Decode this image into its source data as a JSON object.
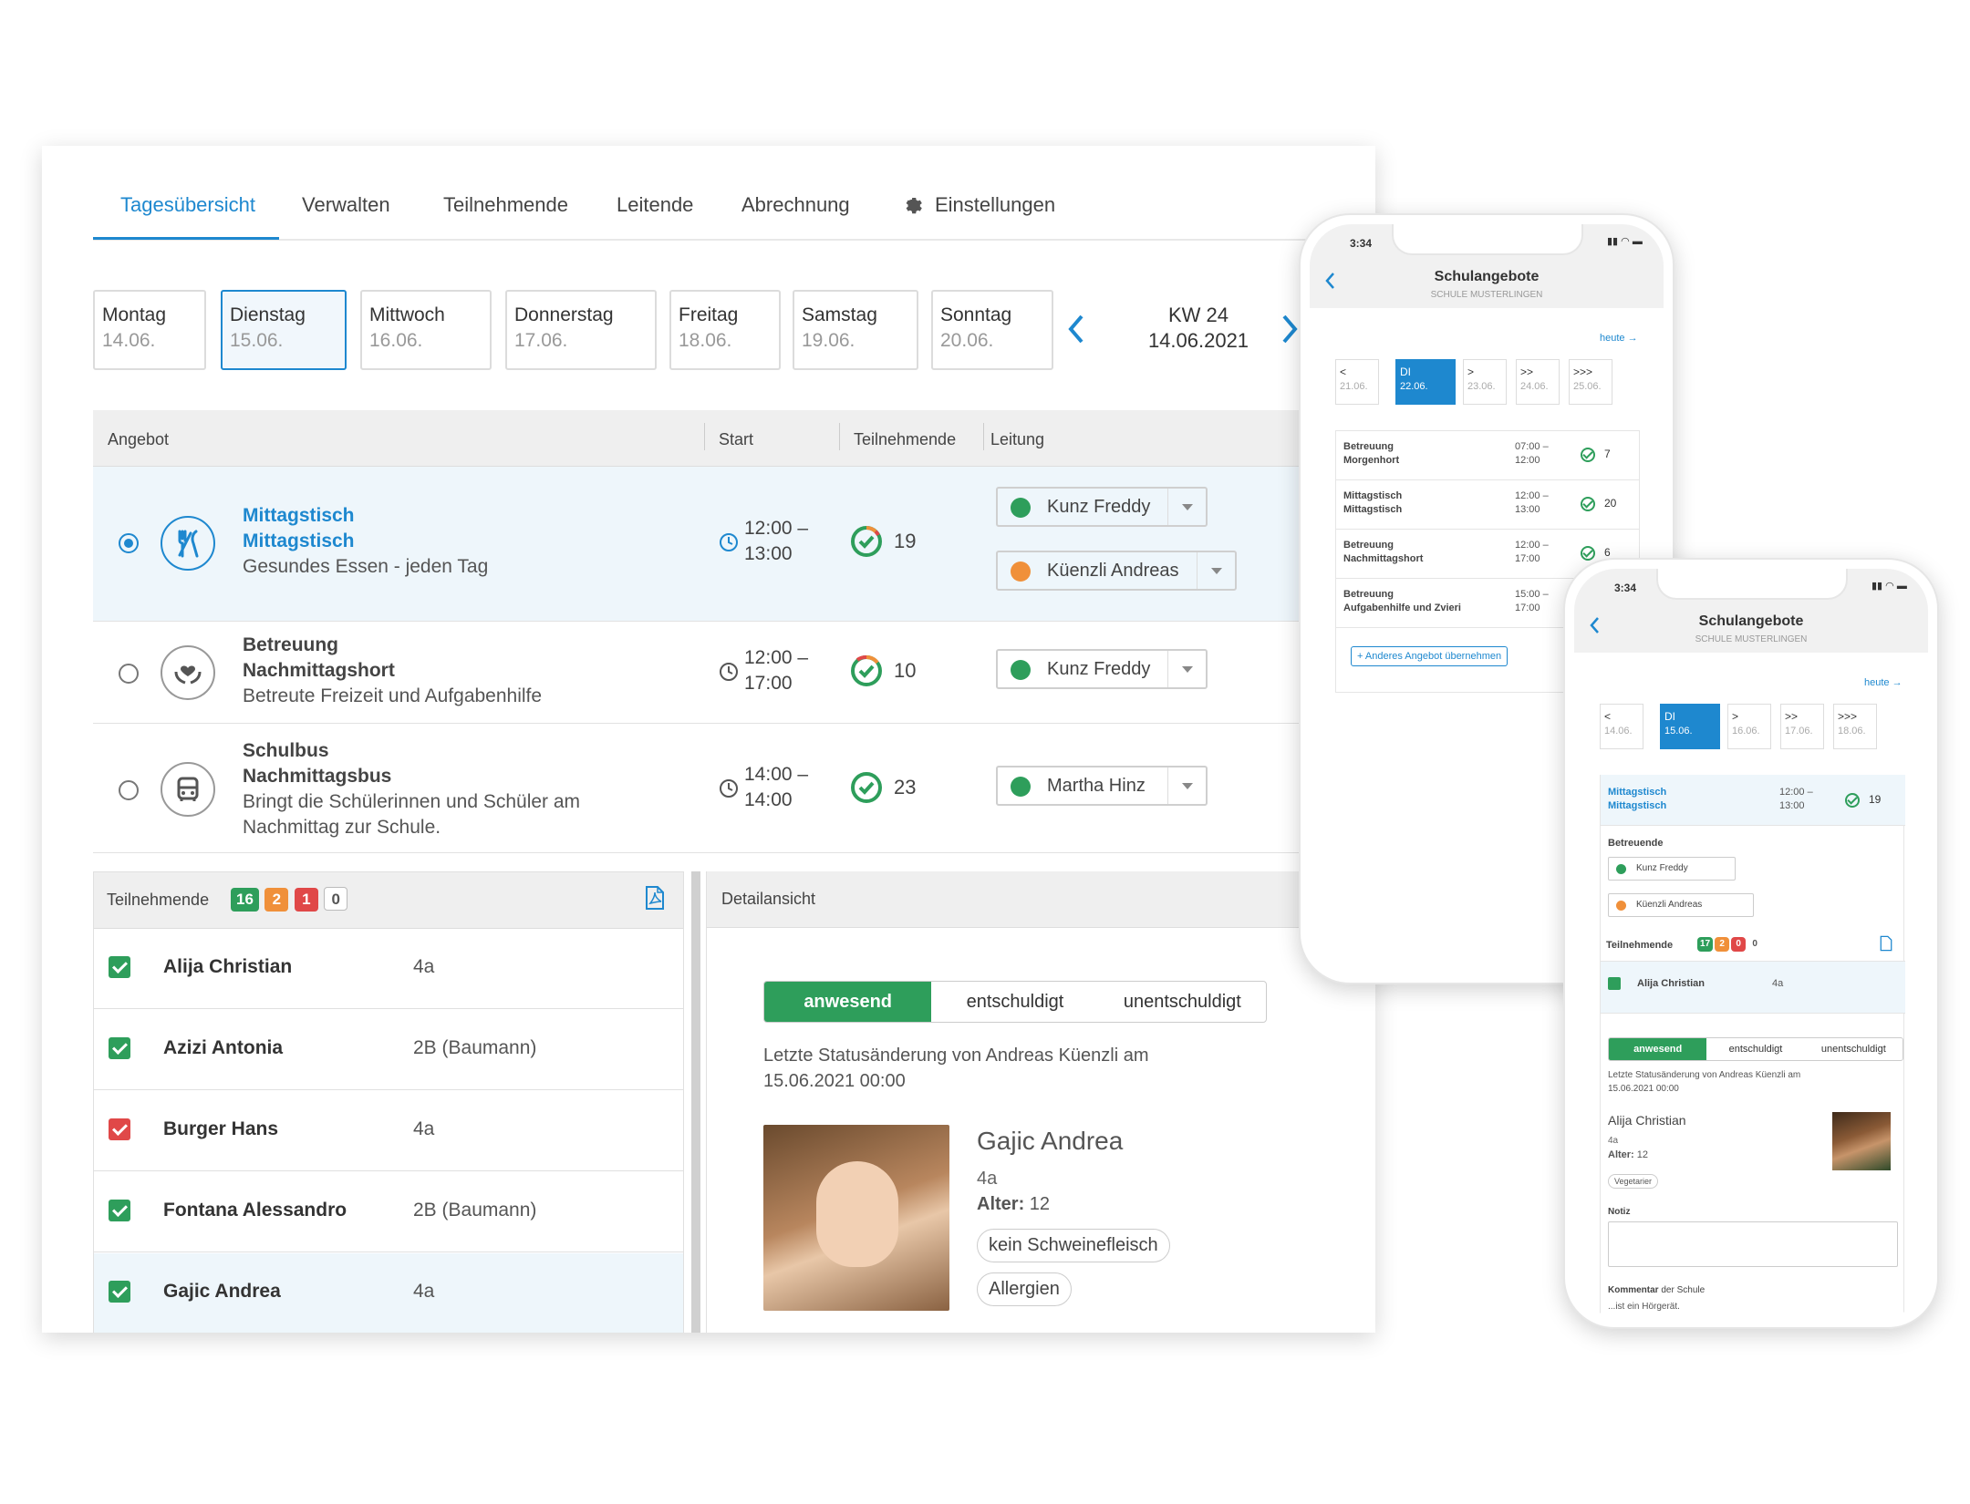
{
  "tabs": [
    "Tagesübersicht",
    "Verwalten",
    "Teilnehmende",
    "Leitende",
    "Abrechnung",
    "Einstellungen"
  ],
  "days": [
    {
      "name": "Montag",
      "date": "14.06."
    },
    {
      "name": "Dienstag",
      "date": "15.06."
    },
    {
      "name": "Mittwoch",
      "date": "16.06."
    },
    {
      "name": "Donnerstag",
      "date": "17.06."
    },
    {
      "name": "Freitag",
      "date": "18.06."
    },
    {
      "name": "Samstag",
      "date": "19.06."
    },
    {
      "name": "Sonntag",
      "date": "20.06."
    }
  ],
  "week": {
    "label": "KW 24",
    "date": "14.06.2021"
  },
  "table": {
    "headers": [
      "Angebot",
      "Start",
      "Teilnehmende",
      "Leitung"
    ],
    "rows": [
      {
        "line1": "Mittagstisch",
        "line2": "Mittagstisch",
        "line3": "Gesundes Essen - jeden Tag",
        "start": "12:00 –",
        "end": "13:00",
        "count": "19",
        "leaders": [
          "Kunz Freddy",
          "Küenzli Andreas"
        ]
      },
      {
        "line1": "Betreuung",
        "line2": "Nachmittagshort",
        "line3": "Betreute Freizeit und Aufgabenhilfe",
        "start": "12:00 –",
        "end": "17:00",
        "count": "10",
        "leaders": [
          "Kunz Freddy"
        ]
      },
      {
        "line1": "Schulbus",
        "line2": "Nachmittagsbus",
        "line3": "Bringt die Schülerinnen und Schüler am",
        "line4": "Nachmittag zur Schule.",
        "start": "14:00 –",
        "end": "14:00",
        "count": "23",
        "leaders": [
          "Martha Hinz"
        ]
      }
    ]
  },
  "participants": {
    "title": "Teilnehmende",
    "badges": [
      "16",
      "2",
      "1",
      "0"
    ],
    "list": [
      {
        "name": "Alija Christian",
        "class": "4a",
        "status": "present"
      },
      {
        "name": "Azizi Antonia",
        "class": "2B (Baumann)",
        "status": "present"
      },
      {
        "name": "Burger Hans",
        "class": "4a",
        "status": "absent"
      },
      {
        "name": "Fontana Alessandro",
        "class": "2B (Baumann)",
        "status": "present"
      },
      {
        "name": "Gajic Andrea",
        "class": "4a",
        "status": "present"
      }
    ]
  },
  "detail": {
    "title": "Detailansicht",
    "segments": [
      "anwesend",
      "entschuldigt",
      "unentschuldigt"
    ],
    "status_line1": "Letzte Statusänderung von Andreas Küenzli am",
    "status_line2": "15.06.2021 00:00",
    "name": "Gajic Andrea",
    "class": "4a",
    "age_label": "Alter:",
    "age": "12",
    "tags": [
      "kein Schweinefleisch",
      "Allergien"
    ]
  },
  "phone1": {
    "time": "3:34",
    "title": "Schulangebote",
    "subtitle": "SCHULE MUSTERLINGEN",
    "today": "heute",
    "days": [
      {
        "a": "<",
        "d": "21.06."
      },
      {
        "a": "DI",
        "d": "22.06."
      },
      {
        "a": ">",
        "d": "23.06."
      },
      {
        "a": ">>",
        "d": "24.06."
      },
      {
        "a": ">>>",
        "d": "25.06."
      }
    ],
    "rows": [
      {
        "l1": "Betreuung",
        "l2": "Morgenhort",
        "t1": "07:00 –",
        "t2": "12:00",
        "c": "7"
      },
      {
        "l1": "Mittagstisch",
        "l2": "Mittagstisch",
        "t1": "12:00 –",
        "t2": "13:00",
        "c": "20"
      },
      {
        "l1": "Betreuung",
        "l2": "Nachmittagshort",
        "t1": "12:00 –",
        "t2": "17:00",
        "c": "6"
      },
      {
        "l1": "Betreuung",
        "l2": "Aufgabenhilfe und Zvieri",
        "t1": "15:00 –",
        "t2": "17:00",
        "c": ""
      }
    ],
    "button": "+ Anderes Angebot übernehmen"
  },
  "phone2": {
    "time": "3:34",
    "title": "Schulangebote",
    "subtitle": "SCHULE MUSTERLINGEN",
    "today": "heute",
    "days": [
      {
        "a": "<",
        "d": "14.06."
      },
      {
        "a": "DI",
        "d": "15.06."
      },
      {
        "a": ">",
        "d": "16.06."
      },
      {
        "a": ">>",
        "d": "17.06."
      },
      {
        "a": ">>>",
        "d": "18.06."
      }
    ],
    "offer": {
      "l1": "Mittagstisch",
      "l2": "Mittagstisch",
      "t1": "12:00 –",
      "t2": "13:00",
      "c": "19"
    },
    "leaders_title": "Betreuende",
    "leaders": [
      "Kunz Freddy",
      "Küenzli Andreas"
    ],
    "part_title": "Teilnehmende",
    "badges": [
      "17",
      "2",
      "0",
      "0"
    ],
    "person": {
      "name": "Alija Christian",
      "class": "4a"
    },
    "segments": [
      "anwesend",
      "entschuldigt",
      "unentschuldigt"
    ],
    "status_line1": "Letzte Statusänderung von Andreas Küenzli am",
    "status_line2": "15.06.2021 00:00",
    "detail_name": "Alija Christian",
    "detail_class": "4a",
    "age_label": "Alter:",
    "age": "12",
    "tag": "Vegetarier",
    "note_label": "Notiz",
    "comment_label": "Kommentar",
    "comment_suffix": "der Schule",
    "comment_text": "...ist ein Hörgerät."
  },
  "colors": {
    "accent": "#1e88cf",
    "green": "#2e9e5b",
    "orange": "#f0903a",
    "red": "#e04848"
  }
}
